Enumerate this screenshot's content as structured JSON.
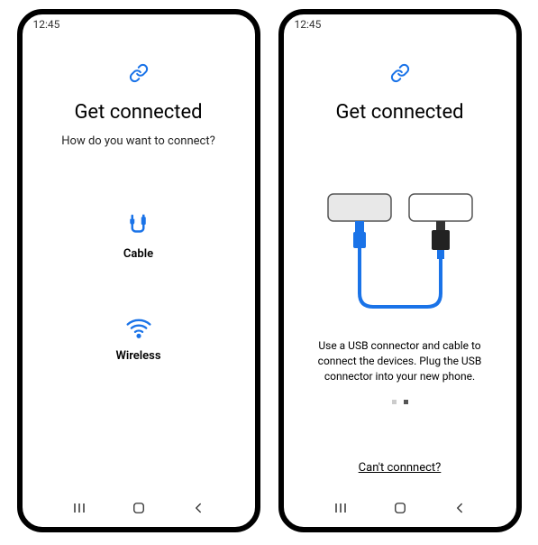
{
  "status": {
    "time": "12:45"
  },
  "left": {
    "title": "Get connected",
    "subtitle": "How do you want to connect?",
    "options": {
      "cable": "Cable",
      "wireless": "Wireless"
    }
  },
  "right": {
    "title": "Get connected",
    "instruction": "Use a USB connector and cable to connect the devices. Plug the USB connector into your new phone.",
    "help_link": "Can't connnect?"
  }
}
